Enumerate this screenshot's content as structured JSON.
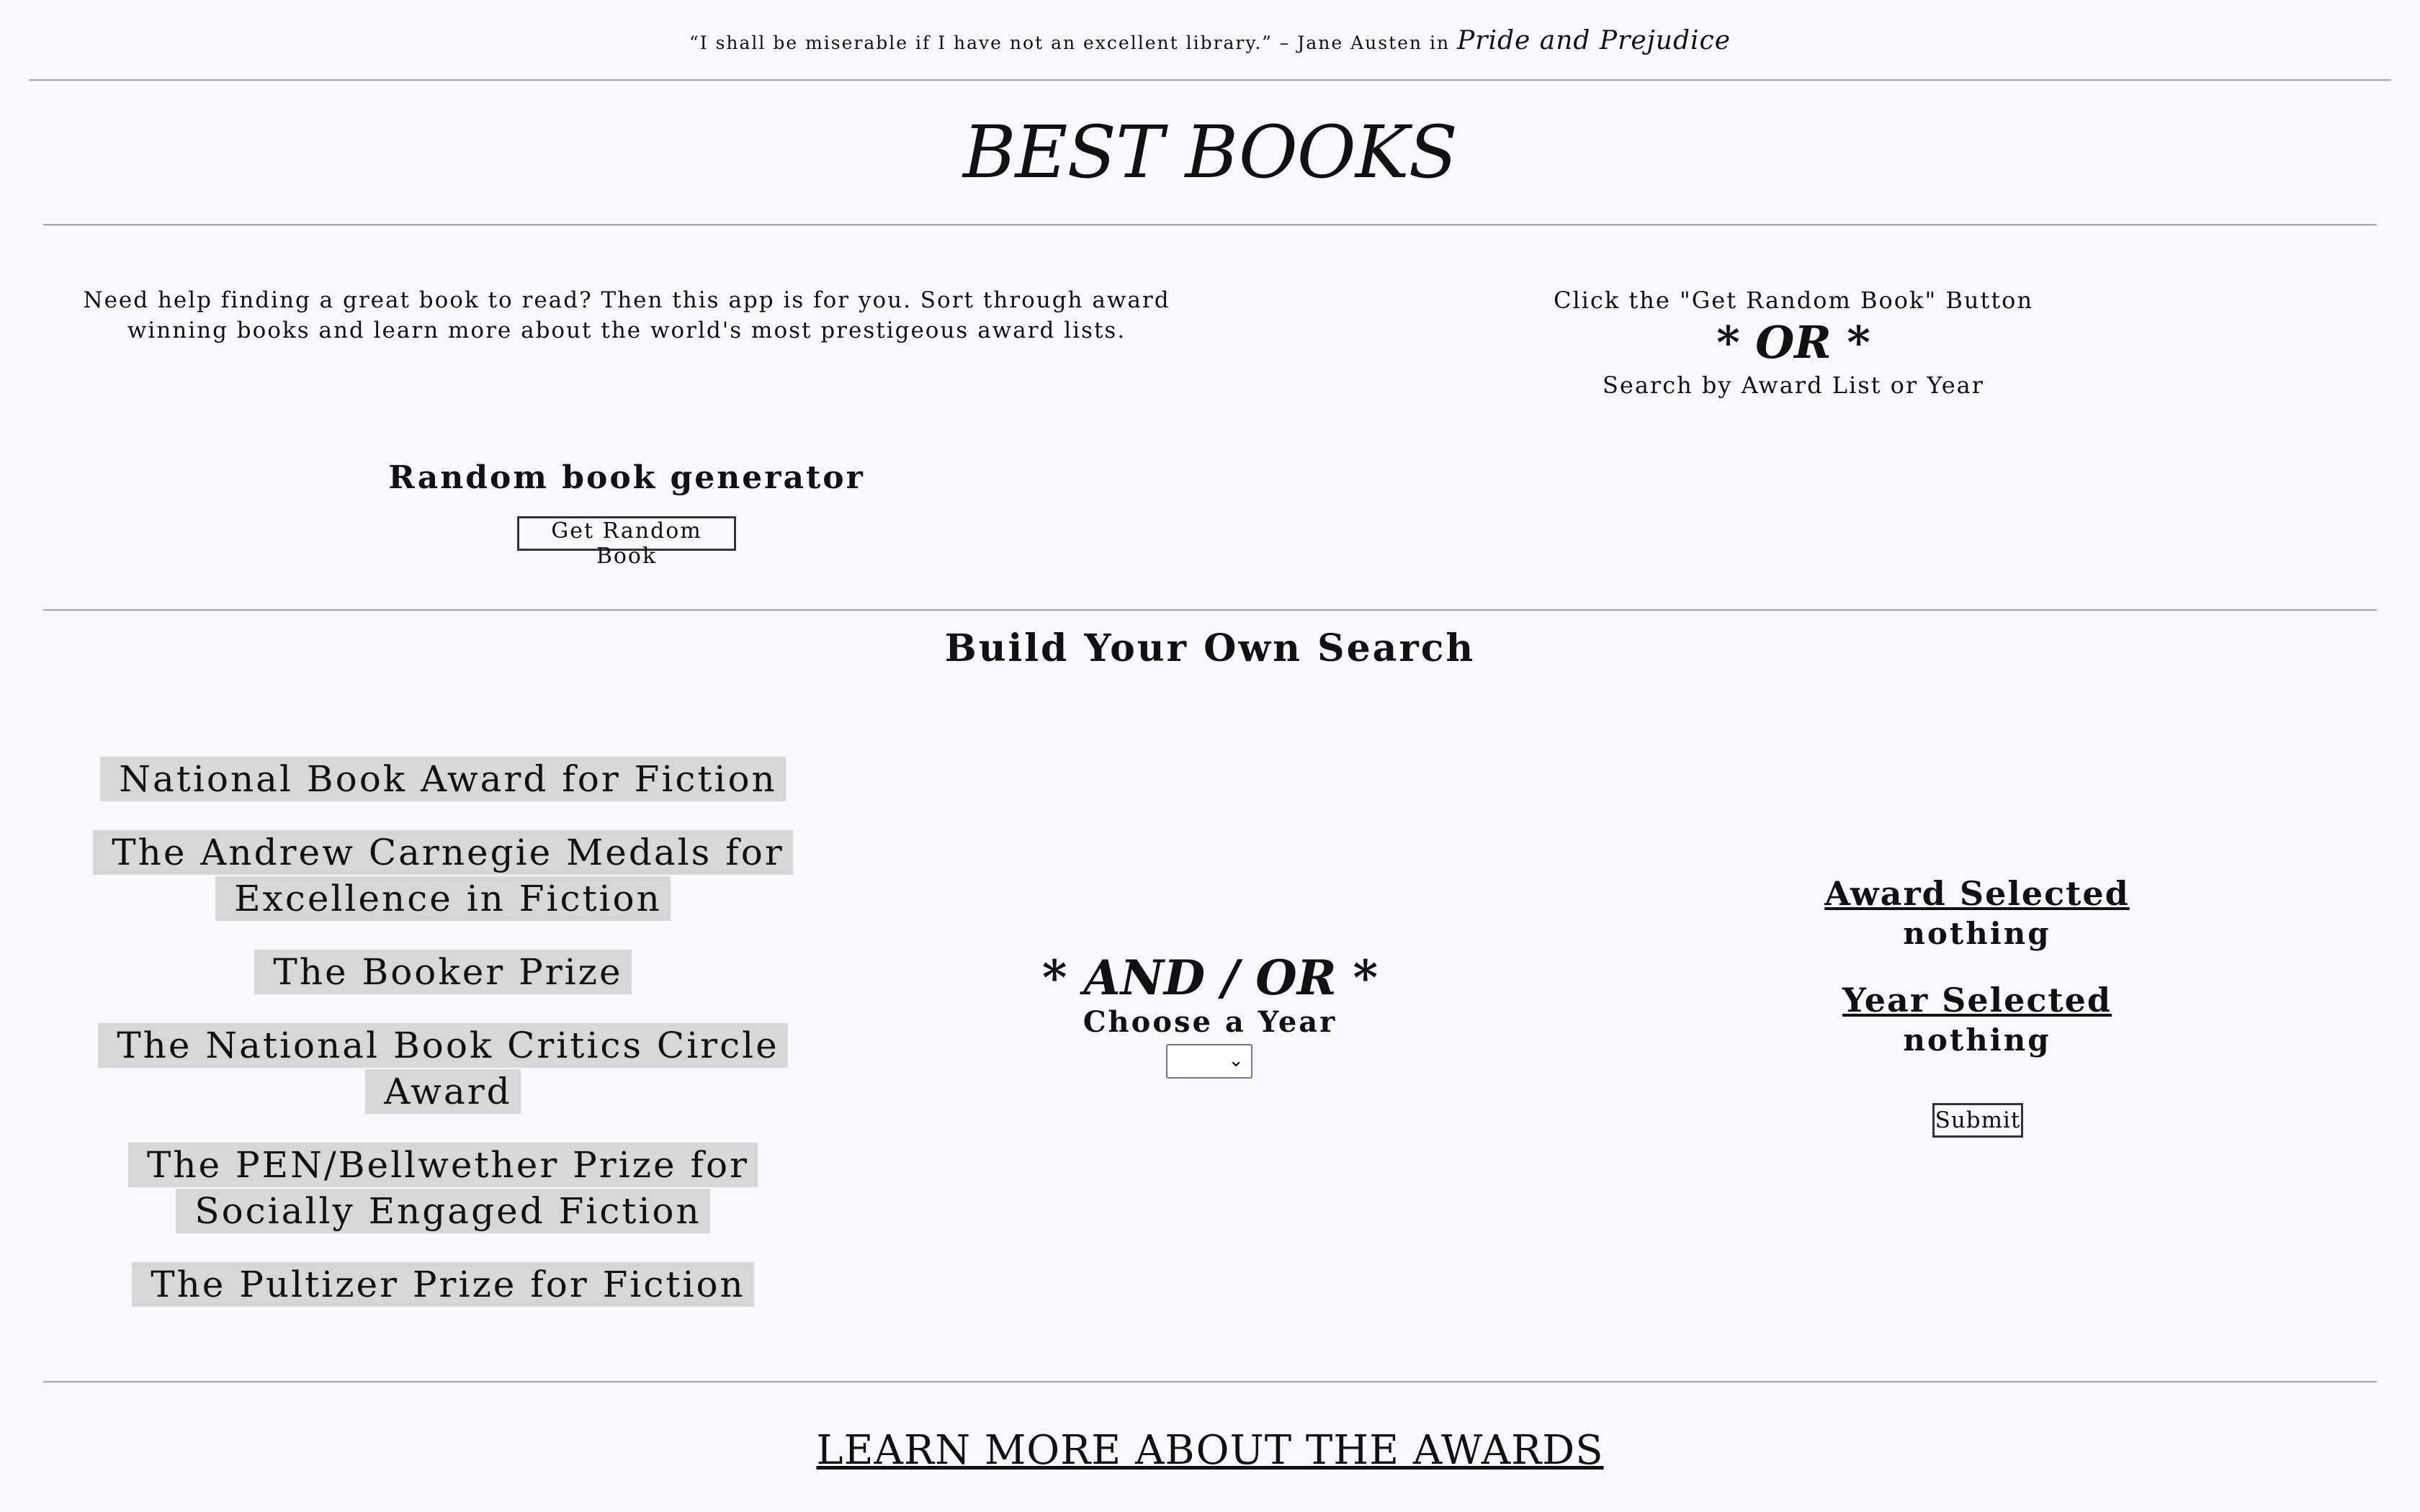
{
  "header": {
    "quote_text": "“I shall be miserable if I have not an excellent library.” – Jane Austen in",
    "quote_work": "Pride and Prejudice",
    "title": "BEST BOOKS"
  },
  "intro": {
    "description": "Need help finding a great book to read? Then this app is for you. Sort through award winning books and learn more about the world's most prestigeous award lists.",
    "instruction_1": "Click the \"Get Random Book\" Button",
    "or_label": "* OR *",
    "instruction_2": "Search by Award List or Year"
  },
  "random": {
    "heading": "Random book generator",
    "button_label": "Get Random Book"
  },
  "search": {
    "heading": "Build Your Own Search",
    "awards": [
      "National Book Award for Fiction",
      "The Andrew Carnegie Medals for Excellence in Fiction",
      "The Booker Prize",
      "The National Book Critics Circle Award",
      "The PEN/Bellwether Prize for Socially Engaged Fiction",
      "The Pultizer Prize for Fiction"
    ],
    "andor_label": "* AND / OR *",
    "year_label": "Choose a Year",
    "year_value": "",
    "award_selected_label": "Award Selected",
    "award_selected_value": "nothing",
    "year_selected_label": "Year Selected",
    "year_selected_value": "nothing",
    "submit_label": "Submit"
  },
  "footer": {
    "learn_more_label": "LEARN MORE ABOUT THE AWARDS"
  },
  "icons": {
    "year_dropdown": "chevron-down-icon"
  }
}
